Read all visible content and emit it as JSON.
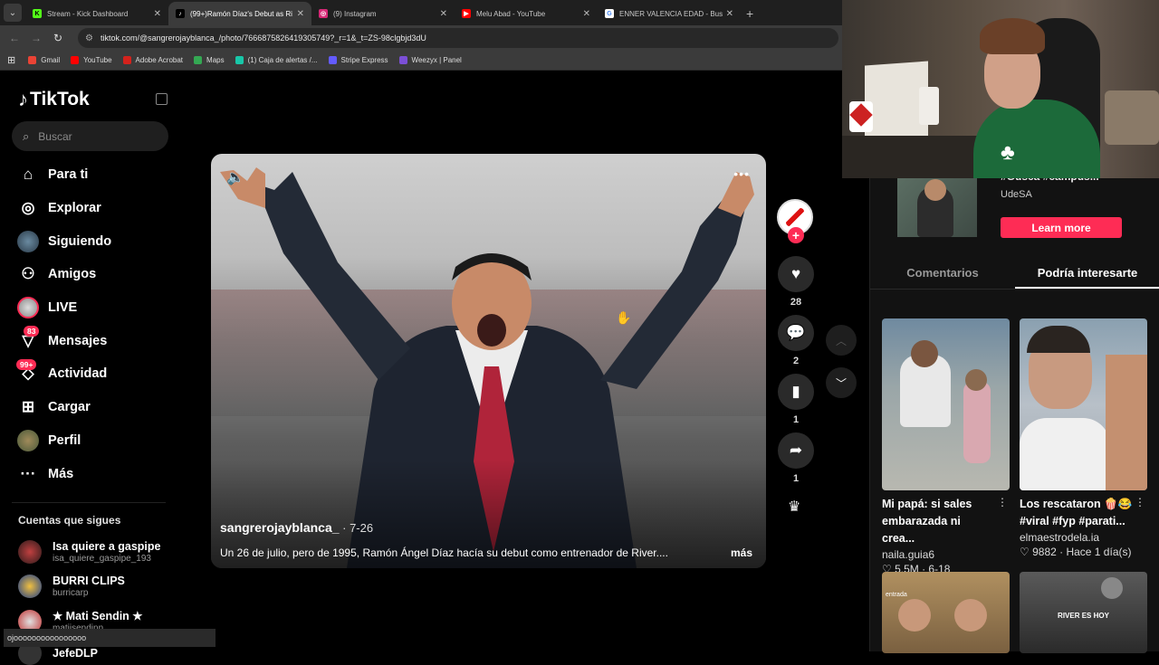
{
  "browser": {
    "tabs": [
      {
        "title": "Stream - Kick Dashboard",
        "color": "#53fc18",
        "glyph": "K"
      },
      {
        "title": "(99+)Ramón Díaz's Debut as Ri",
        "color": "#000000",
        "glyph": "♪"
      },
      {
        "title": "(9) Instagram",
        "color": "#d62976",
        "glyph": "◎"
      },
      {
        "title": "Melu Abad - YouTube",
        "color": "#ff0000",
        "glyph": "▶"
      },
      {
        "title": "ENNER VALENCIA EDAD - Busc",
        "color": "#ffffff",
        "glyph": "G"
      }
    ],
    "url": "tiktok.com/@sangrerojayblanca_/photo/7666875826419305749?_r=1&_t=ZS-98clgbjd3dU",
    "bookmarks": [
      {
        "label": "Gmail",
        "color": "#ea4335"
      },
      {
        "label": "YouTube",
        "color": "#ff0000"
      },
      {
        "label": "Adobe Acrobat",
        "color": "#d4221c"
      },
      {
        "label": "Maps",
        "color": "#34a853"
      },
      {
        "label": "(1) Caja de alertas /...",
        "color": "#18c7a8"
      },
      {
        "label": "Stripe Express",
        "color": "#635bff"
      },
      {
        "label": "Weezyx | Panel",
        "color": "#7b4fd6"
      }
    ]
  },
  "sidebar": {
    "logo": "TikTok",
    "search_placeholder": "Buscar",
    "nav": [
      {
        "label": "Para ti",
        "icon": "home-icon",
        "glyph": "⌂"
      },
      {
        "label": "Explorar",
        "icon": "compass-icon",
        "glyph": "◎"
      },
      {
        "label": "Siguiendo",
        "icon": "following-avatar",
        "glyph": ""
      },
      {
        "label": "Amigos",
        "icon": "friends-icon",
        "glyph": "👥"
      },
      {
        "label": "LIVE",
        "icon": "live-avatar",
        "glyph": ""
      },
      {
        "label": "Mensajes",
        "icon": "messages-icon",
        "glyph": "▽",
        "badge": "83"
      },
      {
        "label": "Actividad",
        "icon": "activity-icon",
        "glyph": "◇",
        "badge": "99+"
      },
      {
        "label": "Cargar",
        "icon": "upload-icon",
        "glyph": "⊞"
      },
      {
        "label": "Perfil",
        "icon": "profile-avatar",
        "glyph": ""
      },
      {
        "label": "Más",
        "icon": "more-icon",
        "glyph": "···"
      }
    ],
    "following_header": "Cuentas que sigues",
    "following": [
      {
        "name": "Isa quiere a gaspipe",
        "user": "isa_quiere_gaspipe_193"
      },
      {
        "name": "BURRI CLIPS",
        "user": "burricarp"
      },
      {
        "name": "★ Mati Sendin ★",
        "user": "matiisendinn"
      },
      {
        "name": "JefeDLP",
        "user": ""
      }
    ]
  },
  "video": {
    "author": "sangrerojayblanca_",
    "date": " · 7-26",
    "description": "Un 26 de julio, pero de 1995, Ramón Ángel Díaz hacía su debut como entrenador de River....",
    "more": "más"
  },
  "actions": {
    "likes": "28",
    "comments": "2",
    "saves": "1",
    "shares": "1"
  },
  "right_panel": {
    "ad_text": "#Gusca #campus...",
    "ad_sub": "UdeSA",
    "learn_more": "Learn more",
    "tabs": [
      "Comentarios",
      "Podría interesarte"
    ],
    "cards": [
      {
        "title": "Mi papá: si sales embarazada ni crea...",
        "author": "naila.guia6",
        "stats": "♡ 5.5M · 6-18"
      },
      {
        "title": "Los rescataron 🍿😂 #viral #fyp #parati...",
        "author": "elmaestrodela.ia",
        "stats": "♡ 9882 · Hace 1 día(s)"
      },
      {
        "title": "",
        "author": "",
        "stats": "",
        "overlay": "entrada"
      },
      {
        "title": "",
        "author": "",
        "stats": "",
        "overlay": "RIVER ES HOY"
      }
    ]
  },
  "toast": "ojoooooooooooooooo"
}
